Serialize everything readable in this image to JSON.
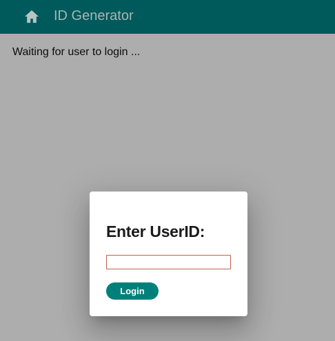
{
  "app_bar": {
    "title": "ID Generator",
    "home_icon": "home-icon",
    "background_color": "#00595a",
    "title_color": "#a9b6b6"
  },
  "main": {
    "status_text": "Waiting for user to login ..."
  },
  "login_dialog": {
    "title": "Enter UserID:",
    "userid_input": {
      "value": "",
      "placeholder": ""
    },
    "login_button_label": "Login",
    "accent_color": "#00807a",
    "input_border_color": "#c0604a"
  }
}
